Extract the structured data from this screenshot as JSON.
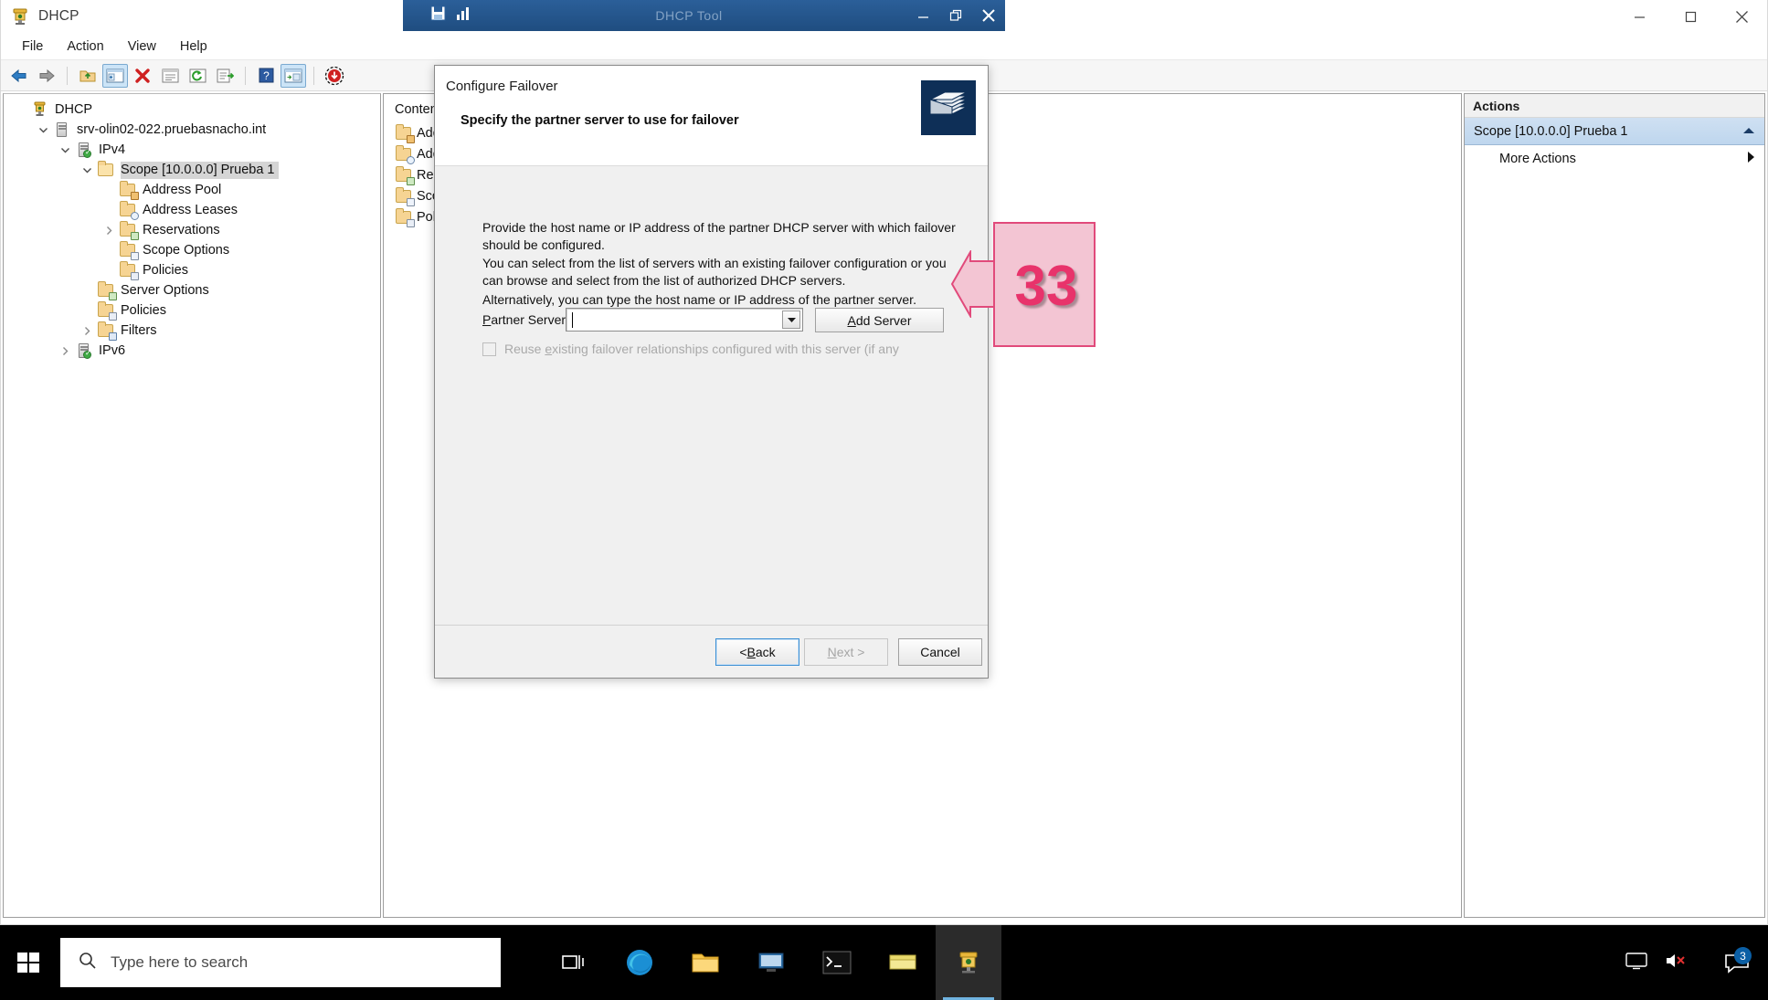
{
  "window": {
    "title": "DHCP",
    "icon": "dhcp-app-icon",
    "controls": {
      "minimize": "minimize-icon",
      "restore": "restore-icon",
      "close": "close-icon"
    }
  },
  "menu": {
    "items": [
      "File",
      "Action",
      "View",
      "Help"
    ]
  },
  "toolbar": {
    "buttons": [
      "back-arrow-icon",
      "forward-arrow-icon",
      "up-folder-icon",
      "show-hide-tree-icon",
      "delete-icon",
      "properties-icon",
      "refresh-icon",
      "export-list-icon",
      "help-icon",
      "show-hide-action-pane-icon",
      "record-icon"
    ]
  },
  "tree": {
    "items": [
      {
        "label": "DHCP",
        "indent": 0,
        "icon": "dhcp-root-icon",
        "chevron": "none",
        "selected": false
      },
      {
        "label": "srv-olin02-022.pruebasnacho.int",
        "indent": 1,
        "icon": "server-icon",
        "chevron": "expanded",
        "selected": false
      },
      {
        "label": "IPv4",
        "indent": 2,
        "icon": "server-ok-icon",
        "chevron": "expanded",
        "selected": false
      },
      {
        "label": "Scope [10.0.0.0] Prueba 1",
        "indent": 3,
        "icon": "folder-open-icon",
        "chevron": "expanded",
        "selected": true
      },
      {
        "label": "Address Pool",
        "indent": 4,
        "icon": "address-pool-folder-icon",
        "chevron": "none",
        "selected": false
      },
      {
        "label": "Address Leases",
        "indent": 4,
        "icon": "address-leases-folder-icon",
        "chevron": "none",
        "selected": false
      },
      {
        "label": "Reservations",
        "indent": 4,
        "icon": "reservations-folder-icon",
        "chevron": "collapsed",
        "selected": false
      },
      {
        "label": "Scope Options",
        "indent": 4,
        "icon": "scope-options-folder-icon",
        "chevron": "none",
        "selected": false
      },
      {
        "label": "Policies",
        "indent": 4,
        "icon": "policies-folder-icon",
        "chevron": "none",
        "selected": false
      },
      {
        "label": "Server Options",
        "indent": 3,
        "icon": "server-options-folder-icon",
        "chevron": "none",
        "selected": false
      },
      {
        "label": "Policies",
        "indent": 3,
        "icon": "policies-folder-icon",
        "chevron": "none",
        "selected": false
      },
      {
        "label": "Filters",
        "indent": 3,
        "icon": "filters-folder-icon",
        "chevron": "collapsed",
        "selected": false
      },
      {
        "label": "IPv6",
        "indent": 2,
        "icon": "server-ok-icon",
        "chevron": "collapsed",
        "selected": false
      }
    ]
  },
  "middle_pane": {
    "header": "Contents",
    "rows": [
      {
        "label": "Address Pool",
        "icon": "address-pool-folder-icon"
      },
      {
        "label": "Address Leases",
        "icon": "address-leases-folder-icon"
      },
      {
        "label": "Reservations",
        "icon": "reservations-folder-icon"
      },
      {
        "label": "Scope Options",
        "icon": "scope-options-folder-icon"
      },
      {
        "label": "Policies",
        "icon": "policies-folder-icon"
      }
    ]
  },
  "actions_pane": {
    "header": "Actions",
    "selected_item": "Scope [10.0.0.0] Prueba 1",
    "selected_chevron": "chevron-up-icon",
    "more_actions": "More Actions",
    "more_actions_chevron": "chevron-right-icon"
  },
  "background_window": {
    "title": "DHCP Tool",
    "icons": [
      "save-icon",
      "chart-icon"
    ],
    "controls": {
      "minimize": "minimize-icon",
      "restore": "restore-icon",
      "close": "close-icon"
    }
  },
  "dialog": {
    "caption": "Configure Failover",
    "subtitle": "Specify the partner server to use for failover",
    "banner_icon": "failover-books-icon",
    "paragraph1": "Provide the host name or IP address of the partner DHCP server with which failover should be configured.",
    "paragraph2": "You can select from the list of servers with an existing failover configuration or you can browse and select from the list of authorized DHCP servers.",
    "paragraph3": "Alternatively, you can type the host name or IP address of the partner server.",
    "partner_label_pre": "P",
    "partner_label_post": "artner Server:",
    "partner_value": "",
    "partner_placeholder": "",
    "combo_caret_icon": "chevron-down-icon",
    "add_server_pre": "A",
    "add_server_post": "dd Server",
    "reuse_checkbox": {
      "pre": "Reuse ",
      "accel": "e",
      "post": "xisting failover relationships configured with this server (if any",
      "checked": false,
      "disabled": true
    },
    "buttons": {
      "back_pre": "< ",
      "back_accel": "B",
      "back_post": "ack",
      "next_accel": "N",
      "next_post": "ext >",
      "next_disabled": true,
      "cancel": "Cancel"
    }
  },
  "annotation": {
    "number": "33",
    "arrow_icon": "left-arrow-annotation",
    "color": "#e8336b",
    "fill": "#f3c5d3"
  },
  "taskbar": {
    "start_icon": "windows-start-icon",
    "search_icon": "search-icon",
    "search_placeholder": "Type here to search",
    "task_view_icon": "task-view-icon",
    "apps": [
      {
        "icon": "edge-browser-icon",
        "active": false
      },
      {
        "icon": "file-explorer-icon",
        "active": false
      },
      {
        "icon": "server-manager-icon",
        "active": false
      },
      {
        "icon": "terminal-icon",
        "active": false
      },
      {
        "icon": "notepad-icon",
        "active": false
      },
      {
        "icon": "dhcp-console-icon",
        "active": true
      }
    ],
    "tray": {
      "display_icon": "display-icon",
      "volume_muted_icon": "volume-muted-icon",
      "clock_top": "",
      "clock_bottom": "",
      "notifications_icon": "notifications-icon",
      "notifications_count": "3"
    }
  }
}
